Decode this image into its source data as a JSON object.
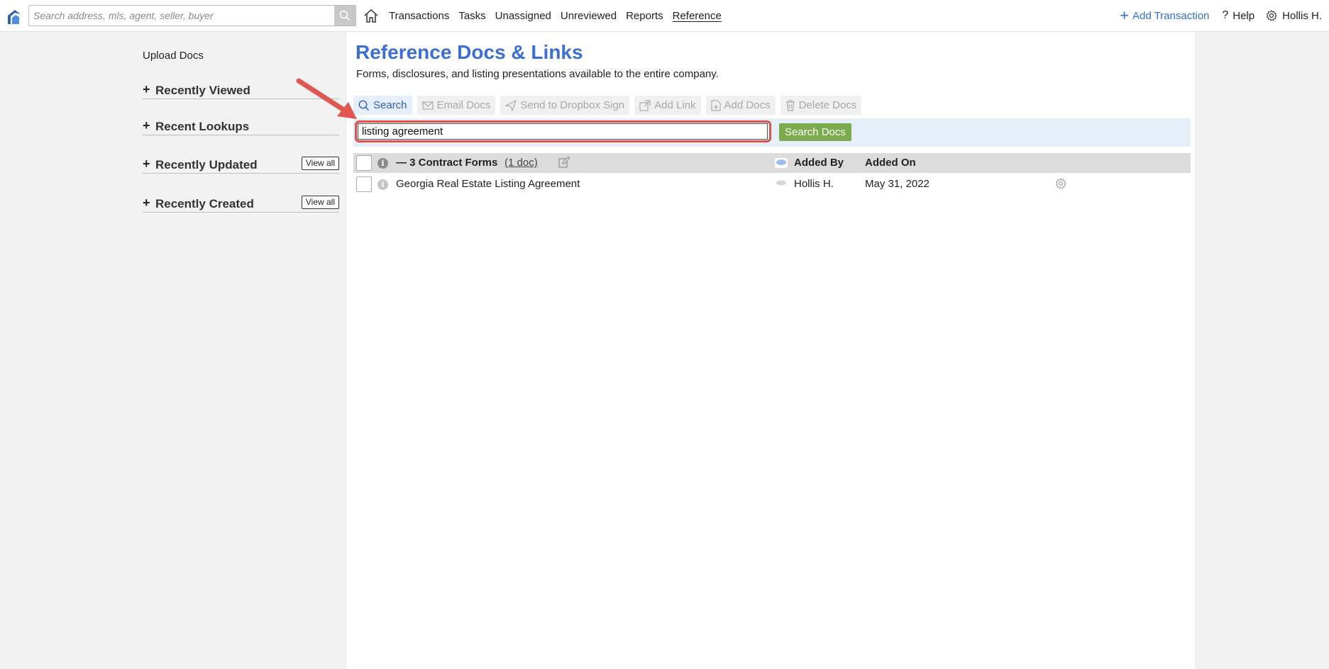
{
  "topbar": {
    "search_placeholder": "Search address, mls, agent, seller, buyer",
    "nav": [
      "Transactions",
      "Tasks",
      "Unassigned",
      "Unreviewed",
      "Reports",
      "Reference"
    ],
    "active_nav": "Reference",
    "add_transaction": "Add Transaction",
    "help": "Help",
    "user": "Hollis H.",
    "brand_color": "#2f6fd6"
  },
  "sidebar": {
    "upload_docs": "Upload Docs",
    "sections": [
      {
        "title": "Recently Viewed",
        "toggle": "+"
      },
      {
        "title": "Recent Lookups",
        "toggle": "+"
      },
      {
        "title": "Recently Updated",
        "toggle": "+",
        "view_all": "View all"
      },
      {
        "title": "Recently Created",
        "toggle": "+",
        "view_all": "View all"
      }
    ]
  },
  "main": {
    "title": "Reference Docs & Links",
    "subtitle": "Forms, disclosures, and listing presentations available to the entire company.",
    "toolbar": {
      "search": "Search",
      "email_docs": "Email Docs",
      "send_dropbox": "Send to Dropbox Sign",
      "add_link": "Add Link",
      "add_docs": "Add Docs",
      "delete_docs": "Delete Docs"
    },
    "query": "listing agreement",
    "search_docs_button": "Search Docs",
    "table": {
      "group_toggle": "—",
      "group_title": "3 Contract Forms",
      "group_count": "(1 doc)",
      "col_added_by": "Added By",
      "col_added_on": "Added On",
      "rows": [
        {
          "name": "Georgia Real Estate Listing Agreement",
          "added_by": "Hollis H.",
          "added_on": "May 31, 2022"
        }
      ]
    },
    "accent_title_color": "#3b6fd4",
    "highlight_color": "#e0514a",
    "button_green": "#7aab4c"
  }
}
